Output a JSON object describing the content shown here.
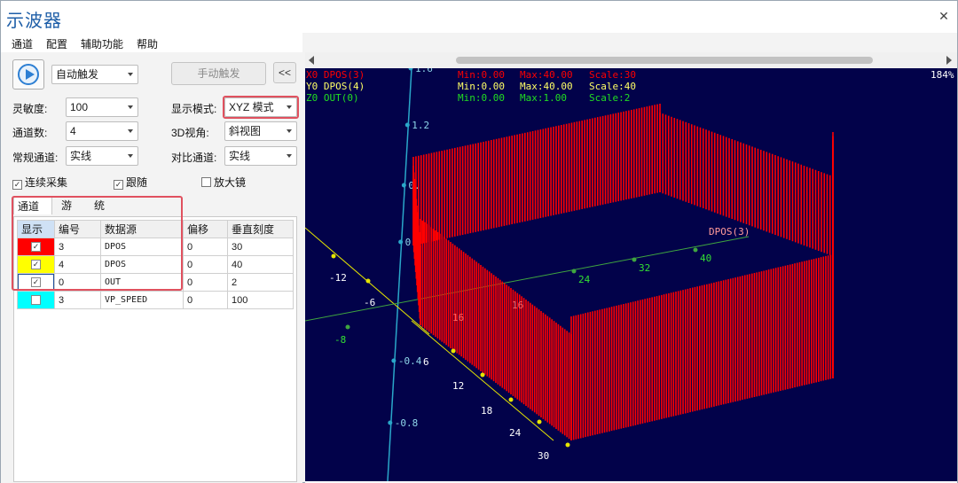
{
  "window": {
    "title": "示波器"
  },
  "menu": [
    "通道",
    "配置",
    "辅助功能",
    "帮助"
  ],
  "controls": {
    "trigger_mode": "自动触发",
    "manual_trigger": "手动触发",
    "collapse": "<<",
    "sensitivity_label": "灵敏度:",
    "sensitivity_value": "100",
    "display_mode_label": "显示模式:",
    "display_mode_value": "XYZ 模式",
    "channels_label": "通道数:",
    "channels_value": "4",
    "view3d_label": "3D视角:",
    "view3d_value": "斜视图",
    "normal_channel_label": "常规通道:",
    "normal_channel_value": "实线",
    "compare_channel_label": "对比通道:",
    "compare_channel_value": "实线",
    "continuous_label": "连续采集",
    "follow_label": "跟随",
    "magnifier_label": "放大镜"
  },
  "tabs": [
    "通道号",
    "游标",
    "统计"
  ],
  "table": {
    "headers": [
      "显示",
      "编号",
      "数据源",
      "偏移",
      "垂直刻度"
    ],
    "rows": [
      {
        "color": "#ff0000",
        "checked": true,
        "num": "3",
        "source": "DPOS",
        "offset": "0",
        "scale": "30"
      },
      {
        "color": "#ffff00",
        "checked": true,
        "num": "4",
        "source": "DPOS",
        "offset": "0",
        "scale": "40"
      },
      {
        "color": "#ffffff",
        "checked": true,
        "num": "0",
        "source": "OUT",
        "offset": "0",
        "scale": "2"
      },
      {
        "color": "#00ffff",
        "checked": false,
        "num": "3",
        "source": "VP_SPEED",
        "offset": "0",
        "scale": "100"
      }
    ]
  },
  "plot": {
    "zoom": "184%",
    "legend": [
      {
        "name": "X0 DPOS(3)",
        "min": "Min:0.00",
        "max": "Max:40.00",
        "scale": "Scale:30",
        "color": "#ff0000"
      },
      {
        "name": "Y0 DPOS(4)",
        "min": "Min:0.00",
        "max": "Max:40.00",
        "scale": "Scale:40",
        "color": "#ffff66"
      },
      {
        "name": "Z0 OUT(0)",
        "min": "Min:0.00",
        "max": "Max:1.00",
        "scale": "Scale:2",
        "color": "#22dd22"
      }
    ],
    "z_ticks": [
      "1.6",
      "1.2",
      "0.",
      "0.",
      "-0.4",
      "-0.8"
    ],
    "x_ticks": [
      "24",
      "32",
      "40"
    ],
    "x_neg_ticks": [
      "-12",
      "-6",
      "-8"
    ],
    "y_ticks": [
      "6",
      "12",
      "18",
      "24",
      "30"
    ],
    "axis_label": "DPOS(3)",
    "misc_labels": [
      "16",
      "16"
    ],
    "colors": {
      "trace": "#ff0000",
      "background": "#02024a",
      "z_axis": "#2aa7c9",
      "x_axis": "#3fa53f",
      "y_axis": "#e6e600"
    }
  }
}
